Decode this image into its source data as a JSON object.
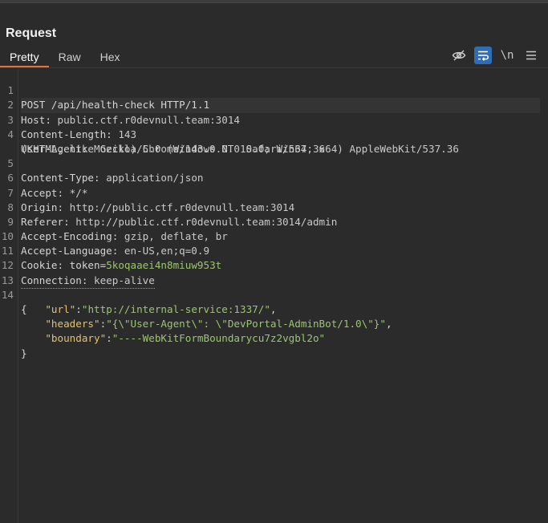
{
  "panel": {
    "title": "Request",
    "tabs": [
      {
        "label": "Pretty",
        "active": true
      },
      {
        "label": "Raw",
        "active": false
      },
      {
        "label": "Hex",
        "active": false
      }
    ],
    "toolbar": {
      "hide_icon": "eye-slash-icon",
      "wrap_icon": "wrap-lines-icon",
      "newline_label": "\\n",
      "menu_icon": "hamburger-icon"
    }
  },
  "request": {
    "line_numbers": [
      "1",
      "2",
      "3",
      "4",
      "5",
      "6",
      "7",
      "8",
      "9",
      "10",
      "11",
      "12",
      "13",
      "14"
    ],
    "request_line": "POST /api/health-check HTTP/1.1",
    "headers": [
      {
        "name": "Host",
        "value": "public.ctf.r0devnull.team:3014"
      },
      {
        "name": "Content-Length",
        "value": "143"
      },
      {
        "name": "User-Agent",
        "value": "Mozilla/5.0 (Windows NT 10.0; Win64; x64) AppleWebKit/537.36",
        "value_cont": "(KHTML, like Gecko) Chrome/143.0.0.0 Safari/537.36"
      },
      {
        "name": "Content-Type",
        "value": "application/json"
      },
      {
        "name": "Accept",
        "value": "*/*"
      },
      {
        "name": "Origin",
        "value": "http://public.ctf.r0devnull.team:3014"
      },
      {
        "name": "Referer",
        "value": "http://public.ctf.r0devnull.team:3014/admin"
      },
      {
        "name": "Accept-Encoding",
        "value": "gzip, deflate, br"
      },
      {
        "name": "Accept-Language",
        "value": "en-US,en;q=0.9"
      }
    ],
    "cookie": {
      "header": "Cookie",
      "name": "token",
      "value": "5koqaaei4n8miuw953t"
    },
    "connection": {
      "name": "Connection",
      "value": "keep-alive"
    },
    "body": {
      "open": "{",
      "close": "}",
      "fields": [
        {
          "key": "\"url\"",
          "value": "\"http://internal-service:1337/\"",
          "trail": ","
        },
        {
          "key": "\"headers\"",
          "value": "\"{\\\"User-Agent\\\": \\\"DevPortal-AdminBot/1.0\\\"}\"",
          "trail": ","
        },
        {
          "key": "\"boundary\"",
          "value": "\"----WebKitFormBoundarycu7z2vgbl2o\"",
          "trail": ""
        }
      ]
    }
  }
}
